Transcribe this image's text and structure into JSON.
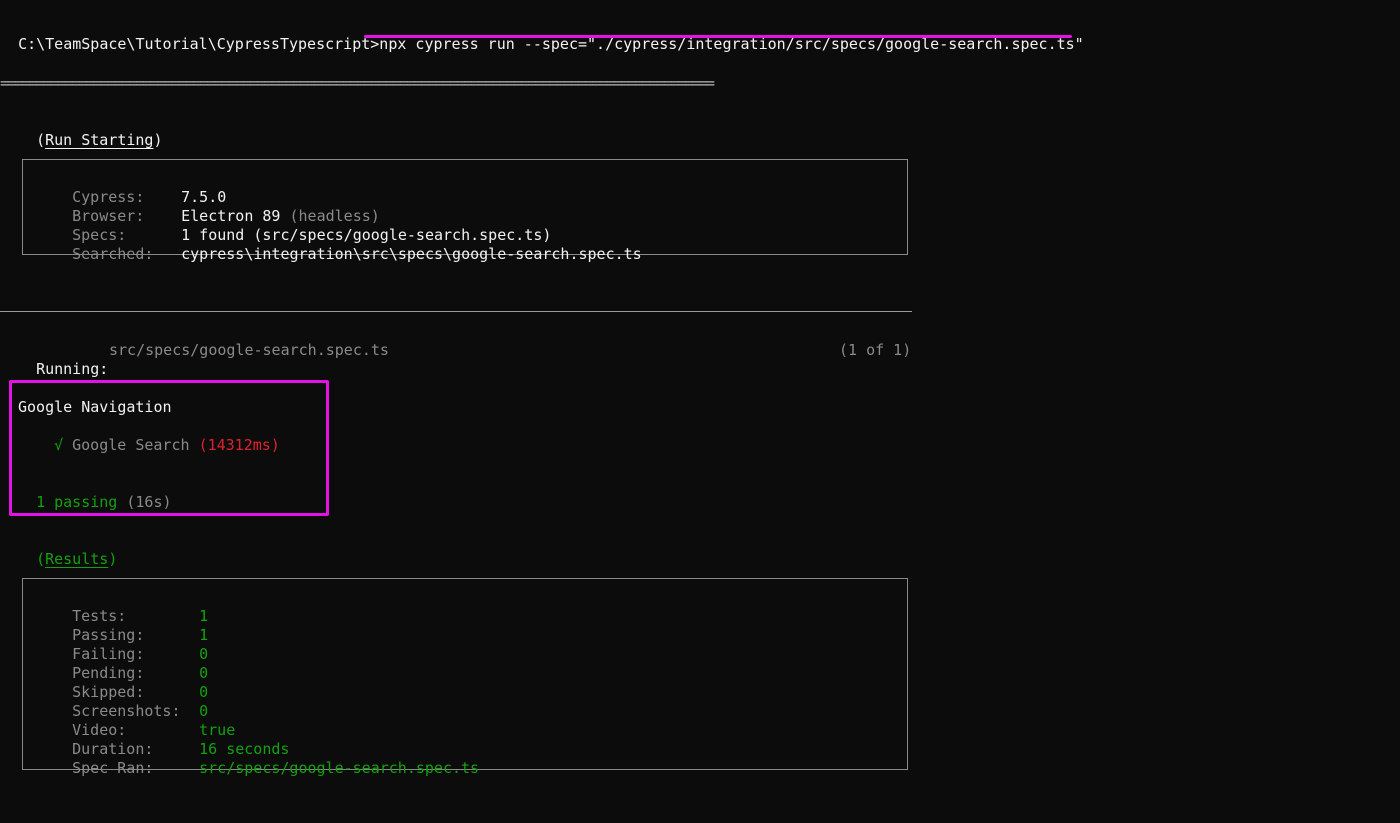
{
  "prompt": {
    "path": "C:\\TeamSpace\\Tutorial\\CypressTypescript>",
    "command": "npx cypress run --spec=\"./cypress/integration/src/specs/google-search.spec.ts\""
  },
  "separator": "====================================================================================================",
  "run_starting": {
    "open": "(",
    "label": "Run Starting",
    "close": ")",
    "rows": [
      {
        "key": "Cypress:",
        "value": "7.5.0",
        "extra": ""
      },
      {
        "key": "Browser:",
        "value": "Electron 89",
        "extra": " (headless)"
      },
      {
        "key": "Specs:",
        "value": "1 found (src/specs/google-search.spec.ts)",
        "extra": ""
      },
      {
        "key": "Searched:",
        "value": "cypress\\integration\\src\\specs\\google-search.spec.ts",
        "extra": ""
      }
    ]
  },
  "running": {
    "label": "Running:",
    "spec": "src/specs/google-search.spec.ts",
    "counter": "(1 of 1)"
  },
  "suite": {
    "name": "Google Navigation",
    "check": "√",
    "test_name": "Google Search",
    "duration": "(14312ms)",
    "passing": "1 passing",
    "passing_time": "(16s)"
  },
  "results": {
    "open": "(",
    "label": "Results",
    "close": ")",
    "rows": [
      {
        "key": "Tests:",
        "value": "1"
      },
      {
        "key": "Passing:",
        "value": "1"
      },
      {
        "key": "Failing:",
        "value": "0"
      },
      {
        "key": "Pending:",
        "value": "0"
      },
      {
        "key": "Skipped:",
        "value": "0"
      },
      {
        "key": "Screenshots:",
        "value": "0"
      },
      {
        "key": "Video:",
        "value": "true"
      },
      {
        "key": "Duration:",
        "value": "16 seconds"
      },
      {
        "key": "Spec Ran:",
        "value": "src/specs/google-search.spec.ts"
      }
    ]
  },
  "colors": {
    "background": "#0c0c0c",
    "green": "#13a10e",
    "red": "#e0202e",
    "highlight": "#e512e5"
  }
}
